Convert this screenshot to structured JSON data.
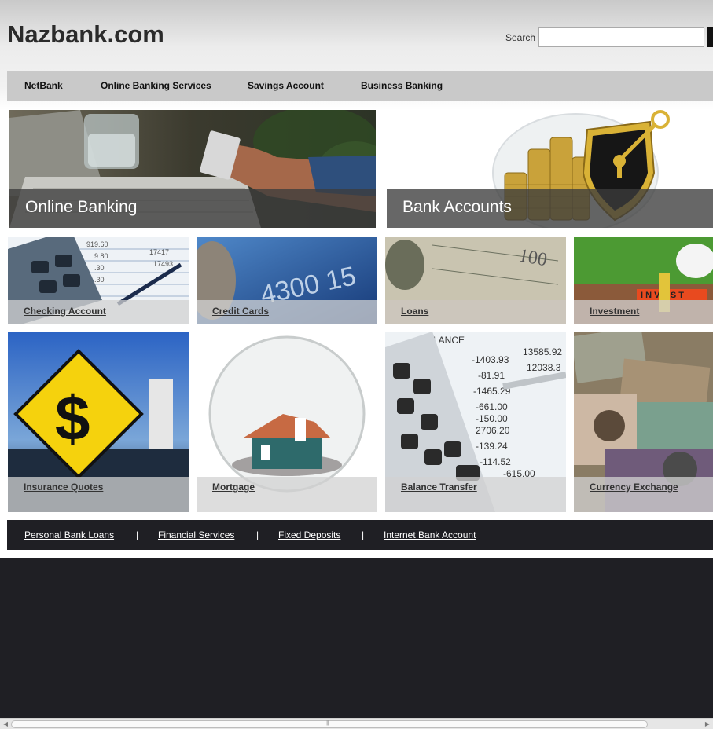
{
  "header": {
    "site_title": "Nazbank.com",
    "search_label": "Search",
    "search_value": ""
  },
  "nav": {
    "items": [
      "NetBank",
      "Online Banking Services",
      "Savings Account",
      "Business Banking"
    ]
  },
  "big_tiles": [
    {
      "label": "Online Banking",
      "image": "laptop-credit-card-photo"
    },
    {
      "label": "Bank Accounts",
      "image": "gold-coins-shield-key-photo"
    }
  ],
  "small_tiles": [
    {
      "label": "Checking Account",
      "image": "calculator-pen-statement-photo"
    },
    {
      "label": "Credit Cards",
      "image": "credit-card-closeup-photo"
    },
    {
      "label": "Loans",
      "image": "dollar-bills-photo"
    },
    {
      "label": "Investment",
      "image": "piggy-bank-invest-save-photo"
    },
    {
      "label": "Insurance Quotes",
      "image": "dollar-road-sign-photo"
    },
    {
      "label": "Mortgage",
      "image": "house-in-glass-globe-photo"
    },
    {
      "label": "Balance Transfer",
      "image": "calculator-balance-sheet-photo"
    },
    {
      "label": "Currency Exchange",
      "image": "world-banknotes-photo"
    }
  ],
  "footer_links": {
    "items": [
      "Personal Bank Loans",
      "Financial Services",
      "Fixed Deposits",
      "Internet Bank Account"
    ],
    "separator": "|"
  },
  "colors": {
    "dark_bg": "#1f1f24",
    "nav_bg": "#c9c9c9",
    "title_text": "#2b2b2b"
  }
}
